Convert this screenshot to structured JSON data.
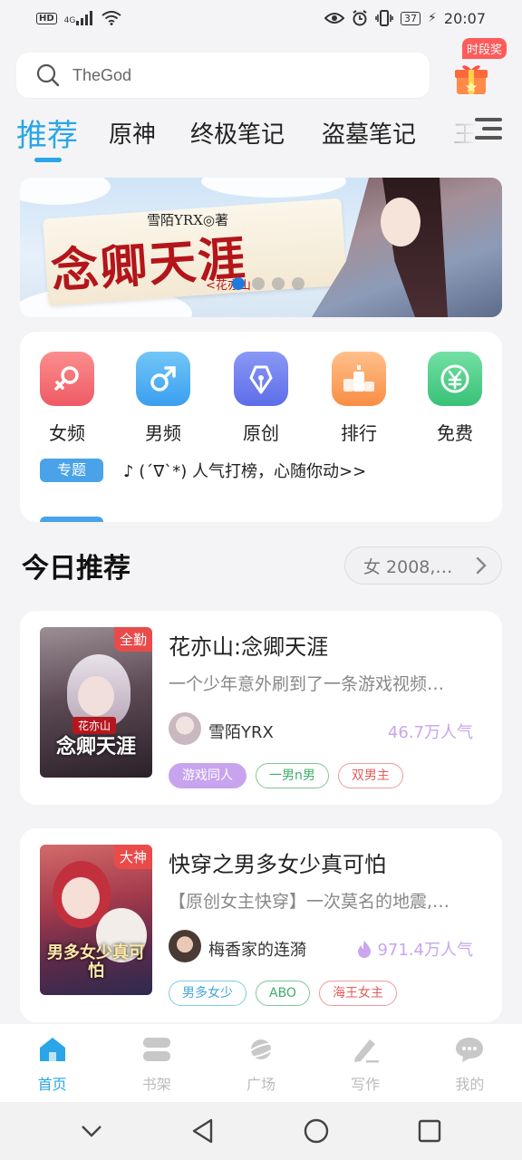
{
  "status_bar": {
    "network": "HD",
    "signal_label": "4G",
    "battery": "37",
    "time": "20:07"
  },
  "search": {
    "query": "TheGod"
  },
  "gift": {
    "label": "时段奖"
  },
  "tabs": [
    "推荐",
    "原神",
    "终极笔记",
    "盗墓笔记",
    "王"
  ],
  "banner": {
    "author": "雪陌YRX◎著",
    "title": "念卿天涯",
    "subtitle": "<花亦山"
  },
  "categories": [
    {
      "label": "女频",
      "icon": "female-icon",
      "color": "#f2686e"
    },
    {
      "label": "男频",
      "icon": "male-icon",
      "color": "#4ab0ef"
    },
    {
      "label": "原创",
      "icon": "pen-nib-icon",
      "color": "#6f7ef0"
    },
    {
      "label": "排行",
      "icon": "podium-icon",
      "color": "#fb9e57"
    },
    {
      "label": "免费",
      "icon": "yen-icon",
      "color": "#4fd08b"
    }
  ],
  "notice": {
    "badge": "专题",
    "text": "♪ (´∇`*) 人气打榜，心随你动>>"
  },
  "section": {
    "title": "今日推荐",
    "filter": "女 2008,…"
  },
  "books": [
    {
      "corner": "全勤",
      "cover_text": "念卿天涯",
      "cover_top": "花亦山",
      "title": "花亦山:念卿天涯",
      "desc": "一个少年意外刷到了一条游戏视频…",
      "author": "雪陌YRX",
      "popularity": "46.7万人气",
      "tags": [
        {
          "text": "游戏同人",
          "style": "filled-purple"
        },
        {
          "text": "一男n男",
          "style": "green"
        },
        {
          "text": "双男主",
          "style": "red"
        }
      ]
    },
    {
      "corner": "大神",
      "cover_text": "男多女少真可怕",
      "title": "快穿之男多女少真可怕",
      "desc": "【原创女主快穿】一次莫名的地震,…",
      "author": "梅香家的连漪",
      "popularity": "971.4万人气",
      "tags": [
        {
          "text": "男多女少",
          "style": "blue"
        },
        {
          "text": "ABO",
          "style": "green"
        },
        {
          "text": "海王女主",
          "style": "red"
        }
      ]
    }
  ],
  "bottom_nav": [
    {
      "label": "首页",
      "icon": "home-icon",
      "active": true
    },
    {
      "label": "书架",
      "icon": "bookshelf-icon",
      "active": false
    },
    {
      "label": "广场",
      "icon": "planet-icon",
      "active": false
    },
    {
      "label": "写作",
      "icon": "pencil-icon",
      "active": false
    },
    {
      "label": "我的",
      "icon": "chat-icon",
      "active": false
    }
  ],
  "colors": {
    "accent": "#2aa6e8",
    "popularity": "#c9a6ee"
  }
}
